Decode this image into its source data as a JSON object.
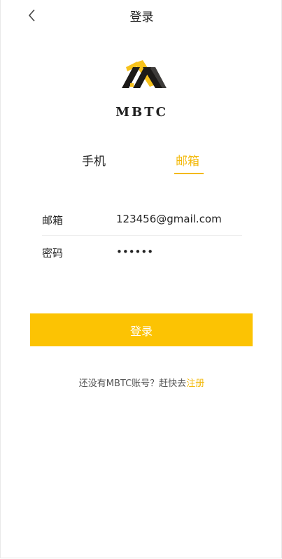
{
  "header": {
    "title": "登录"
  },
  "logo": {
    "brand": "MBTC"
  },
  "tabs": [
    {
      "label": "手机",
      "active": false
    },
    {
      "label": "邮箱",
      "active": true
    }
  ],
  "form": {
    "email_label": "邮箱",
    "email_value": "123456@gmail.com",
    "password_label": "密码",
    "password_value": "••••••"
  },
  "actions": {
    "login_label": "登录"
  },
  "footer": {
    "prompt_text": "还没有MBTC账号？赶快去",
    "register_label": "注册"
  },
  "colors": {
    "accent": "#f3b90a",
    "button": "#fcc303"
  }
}
